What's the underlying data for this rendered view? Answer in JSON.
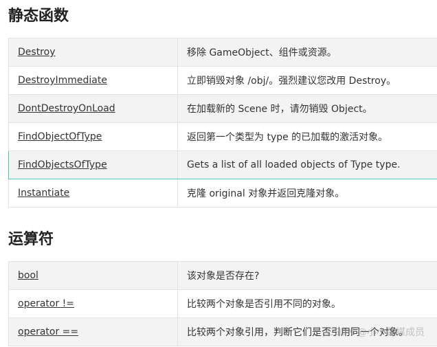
{
  "sections": [
    {
      "title": "静态函数",
      "rows": [
        {
          "name": "Destroy",
          "desc": "移除 GameObject、组件或资源。"
        },
        {
          "name": "DestroyImmediate",
          "desc": "立即销毁对象 /obj/。强烈建议您改用 Destroy。"
        },
        {
          "name": "DontDestroyOnLoad",
          "desc": "在加载新的 Scene 时，请勿销毁 Object。"
        },
        {
          "name": "FindObjectOfType",
          "desc": "返回第一个类型为 type 的已加载的激活对象。"
        },
        {
          "name": "FindObjectsOfType",
          "desc": "Gets a list of all loaded objects of Type type."
        },
        {
          "name": "Instantiate",
          "desc": "克隆 original 对象并返回克隆对象。"
        }
      ]
    },
    {
      "title": "运算符",
      "rows": [
        {
          "name": "bool",
          "desc": "该对象是否存在?"
        },
        {
          "name": "operator !=",
          "desc": "比较两个对象是否引用不同的对象。"
        },
        {
          "name": "operator ==",
          "desc": "比较两个对象引用，判断它们是否引用同一个对象。"
        }
      ]
    }
  ],
  "watermark": "CSDN @小小数媒成员"
}
